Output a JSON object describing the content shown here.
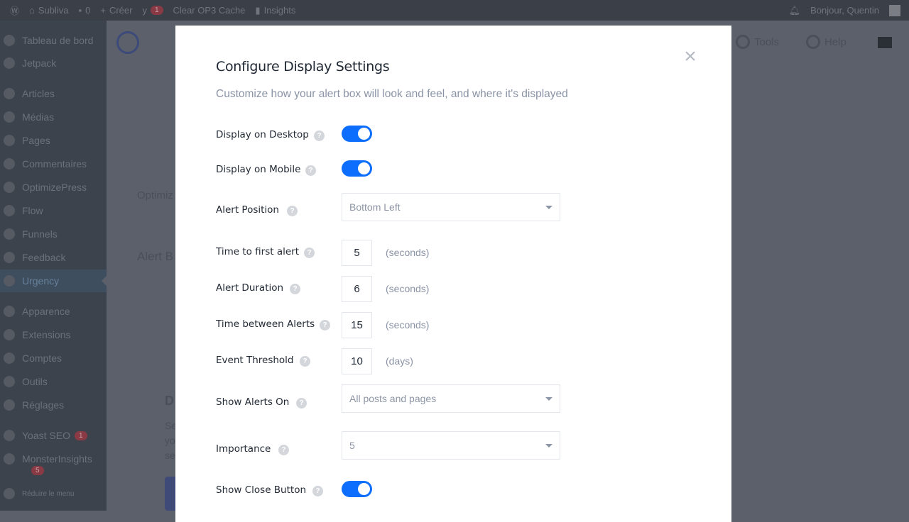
{
  "adminbar": {
    "site": "Subliva",
    "comments": "0",
    "create": "Créer",
    "yoast_badge": "1",
    "cache": "Clear OP3 Cache",
    "insights": "Insights",
    "greeting": "Bonjour, Quentin"
  },
  "sidebar": {
    "items": [
      {
        "label": "Tableau de bord"
      },
      {
        "label": "Jetpack"
      },
      {
        "label": "Articles"
      },
      {
        "label": "Médias"
      },
      {
        "label": "Pages"
      },
      {
        "label": "Commentaires"
      },
      {
        "label": "OptimizePress"
      },
      {
        "label": "Flow"
      },
      {
        "label": "Funnels"
      },
      {
        "label": "Feedback"
      },
      {
        "label": "Urgency",
        "active": true
      },
      {
        "label": "Apparence"
      },
      {
        "label": "Extensions"
      },
      {
        "label": "Comptes"
      },
      {
        "label": "Outils"
      },
      {
        "label": "Réglages"
      },
      {
        "label": "Yoast SEO",
        "badge": "1"
      },
      {
        "label": "MonsterInsights",
        "badge": "5"
      },
      {
        "label": "Réduire le menu"
      }
    ]
  },
  "background": {
    "tools": "Tools",
    "help": "Help",
    "optimize": "Optimiz",
    "alert": "Alert B",
    "d": "D",
    "se1": "Se",
    "yo": "yo",
    "se2": "se"
  },
  "modal": {
    "title": "Configure Display Settings",
    "subtitle": "Customize how your alert box will look and feel, and where it's displayed",
    "help_glyph": "?",
    "fields": {
      "desktop": {
        "label": "Display on Desktop",
        "value": true
      },
      "mobile": {
        "label": "Display on Mobile",
        "value": true
      },
      "position": {
        "label": "Alert Position",
        "value": "Bottom Left"
      },
      "first": {
        "label": "Time to first alert",
        "value": "5",
        "unit": "(seconds)"
      },
      "duration": {
        "label": "Alert Duration",
        "value": "6",
        "unit": "(seconds)"
      },
      "between": {
        "label": "Time between Alerts",
        "value": "15",
        "unit": "(seconds)"
      },
      "threshold": {
        "label": "Event Threshold",
        "value": "10",
        "unit": "(days)"
      },
      "showon": {
        "label": "Show Alerts On",
        "value": "All posts and pages"
      },
      "importance": {
        "label": "Importance",
        "value": "5"
      },
      "closebtn": {
        "label": "Show Close Button",
        "value": true
      }
    }
  },
  "colors": {
    "accent": "#0d6efd",
    "overlay": "#5b606b"
  }
}
